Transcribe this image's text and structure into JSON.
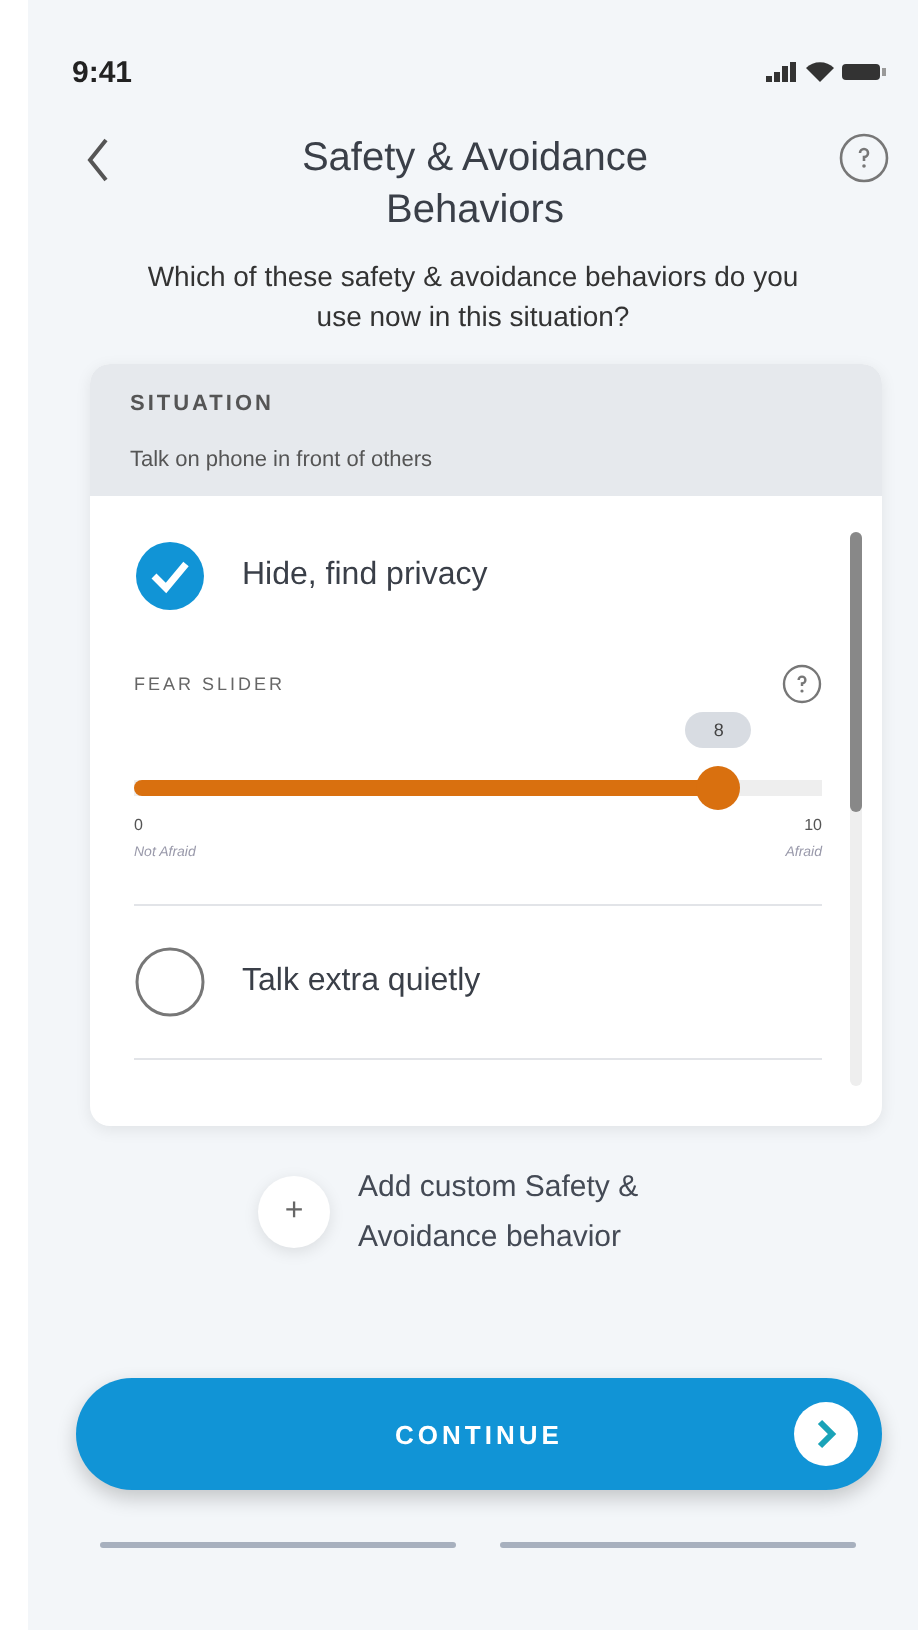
{
  "status_bar": {
    "time": "9:41"
  },
  "header": {
    "title": "Safety & Avoidance Behaviors",
    "subtitle": "Which of these safety & avoidance behaviors do you use now in this situation?"
  },
  "situation": {
    "label": "SITUATION",
    "text": "Talk on phone in front of others"
  },
  "behaviors": [
    {
      "label": "Hide, find privacy",
      "checked": true,
      "slider": {
        "label": "FEAR SLIDER",
        "value": "8",
        "level": 0.85,
        "min": "0",
        "max": "10",
        "min_caption": "Not Afraid",
        "max_caption": "Afraid"
      }
    },
    {
      "label": "Talk extra quietly",
      "checked": false
    }
  ],
  "add_button": {
    "symbol": "+",
    "label": "Add custom Safety & Avoidance behavior"
  },
  "continue_button": {
    "label": "CONTINUE"
  }
}
